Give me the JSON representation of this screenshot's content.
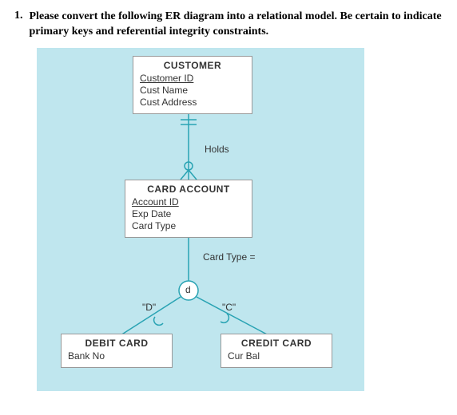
{
  "question": {
    "number": "1.",
    "text": "Please convert the following ER diagram into a relational model. Be certain to indicate primary keys and referential integrity constraints."
  },
  "entities": {
    "customer": {
      "title": "CUSTOMER",
      "pk": "Customer ID",
      "attrs": [
        "Cust Name",
        "Cust Address"
      ]
    },
    "cardAccount": {
      "title": "CARD ACCOUNT",
      "pk": "Account ID",
      "attrs": [
        "Exp Date",
        "Card Type"
      ]
    },
    "debitCard": {
      "title": "DEBIT CARD",
      "attrs": [
        "Bank No"
      ]
    },
    "creditCard": {
      "title": "CREDIT CARD",
      "attrs": [
        "Cur Bal"
      ]
    }
  },
  "labels": {
    "relationship": "Holds",
    "discriminatorExpr": "Card Type =",
    "disjointSymbol": "d",
    "leftVal": "\"D\"",
    "rightVal": "\"C\""
  }
}
